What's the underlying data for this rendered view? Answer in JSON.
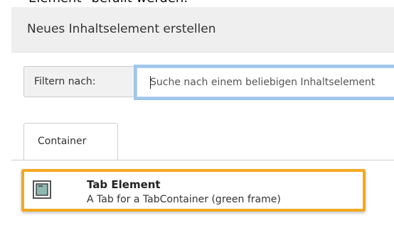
{
  "context": {
    "document_fragment": "Element\" befüllt werden."
  },
  "dialog": {
    "title": "Neues Inhaltselement erstellen"
  },
  "filter": {
    "label": "Filtern nach:",
    "value": "",
    "placeholder": "Suche nach einem beliebigen Inhaltselement"
  },
  "tabs": [
    {
      "label": "Container",
      "active": true
    }
  ],
  "items": [
    {
      "title": "Tab Element",
      "description": "A Tab for a TabContainer (green frame)",
      "icon": "content-element-icon"
    }
  ],
  "colors": {
    "highlight_border": "#f2a91f",
    "focus_ring": "#9fc6ec",
    "header_bg": "#efefef"
  }
}
